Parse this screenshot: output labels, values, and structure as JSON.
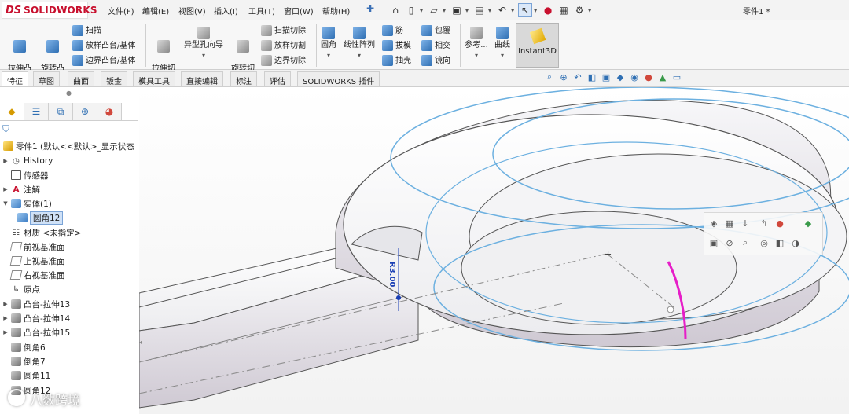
{
  "app": {
    "logo_ds": "DS",
    "logo_name": "SOLIDWORKS",
    "doc_title": "零件1 *"
  },
  "menu": [
    "文件(F)",
    "编辑(E)",
    "视图(V)",
    "插入(I)",
    "工具(T)",
    "窗口(W)",
    "帮助(H)"
  ],
  "quick_tools": [
    "home-icon",
    "new-file-icon",
    "open-file-icon",
    "save-icon",
    "print-icon",
    "undo-icon",
    "select-cursor-icon",
    "traffic-light-icon",
    "file-properties-icon",
    "options-gear-icon"
  ],
  "commands": {
    "extrude_boss": "拉伸凸\n台/基体",
    "revolve_boss": "旋转凸\n台/基体",
    "sweep": "扫描",
    "loft_boss": "放样凸台/基体",
    "boundary_boss": "边界凸台/基体",
    "extrude_cut": "拉伸切\n除",
    "hole_wizard": "异型孔向导",
    "revolve_cut": "旋转切\n除",
    "sweep_cut": "扫描切除",
    "loft_cut": "放样切割",
    "boundary_cut": "边界切除",
    "fillet": "圆角",
    "linear_pattern": "线性阵列",
    "rib": "筋",
    "draft": "拔模",
    "shell": "抽壳",
    "wrap": "包覆",
    "intersect": "相交",
    "mirror": "镜向",
    "reference": "参考...",
    "curves": "曲线",
    "instant3d": "Instant3D"
  },
  "tabs": [
    "特征",
    "草图",
    "曲面",
    "钣金",
    "模具工具",
    "直接编辑",
    "标注",
    "评估",
    "SOLIDWORKS 插件"
  ],
  "tree": {
    "root": "零件1 (默认<<默认>_显示状态",
    "items": [
      {
        "label": "History",
        "icon": "history-icon"
      },
      {
        "label": "传感器",
        "icon": "sensor-icon"
      },
      {
        "label": "注解",
        "icon": "annotation-icon"
      },
      {
        "label": "实体(1)",
        "icon": "solid-bodies-icon"
      },
      {
        "label": "圆角12",
        "icon": "body-icon"
      },
      {
        "label": "材质 <未指定>",
        "icon": "material-icon"
      },
      {
        "label": "前视基准面",
        "icon": "plane-icon"
      },
      {
        "label": "上视基准面",
        "icon": "plane-icon"
      },
      {
        "label": "右视基准面",
        "icon": "plane-icon"
      },
      {
        "label": "原点",
        "icon": "origin-icon"
      },
      {
        "label": "凸台-拉伸13",
        "icon": "extrude-icon"
      },
      {
        "label": "凸台-拉伸14",
        "icon": "extrude-icon"
      },
      {
        "label": "凸台-拉伸15",
        "icon": "extrude-icon"
      },
      {
        "label": "倒角6",
        "icon": "chamfer-icon"
      },
      {
        "label": "倒角7",
        "icon": "chamfer-icon"
      },
      {
        "label": "圆角11",
        "icon": "fillet-icon"
      },
      {
        "label": "圆角12",
        "icon": "fillet-icon"
      }
    ]
  },
  "viewport": {
    "dimension_label": "R3.00"
  },
  "watermark": "八数跨境",
  "colors": {
    "accent": "#2f6fb3",
    "selection_magenta": "#e61ec8",
    "edge_blue": "#6cb0e0",
    "brand_red": "#c8102e"
  }
}
